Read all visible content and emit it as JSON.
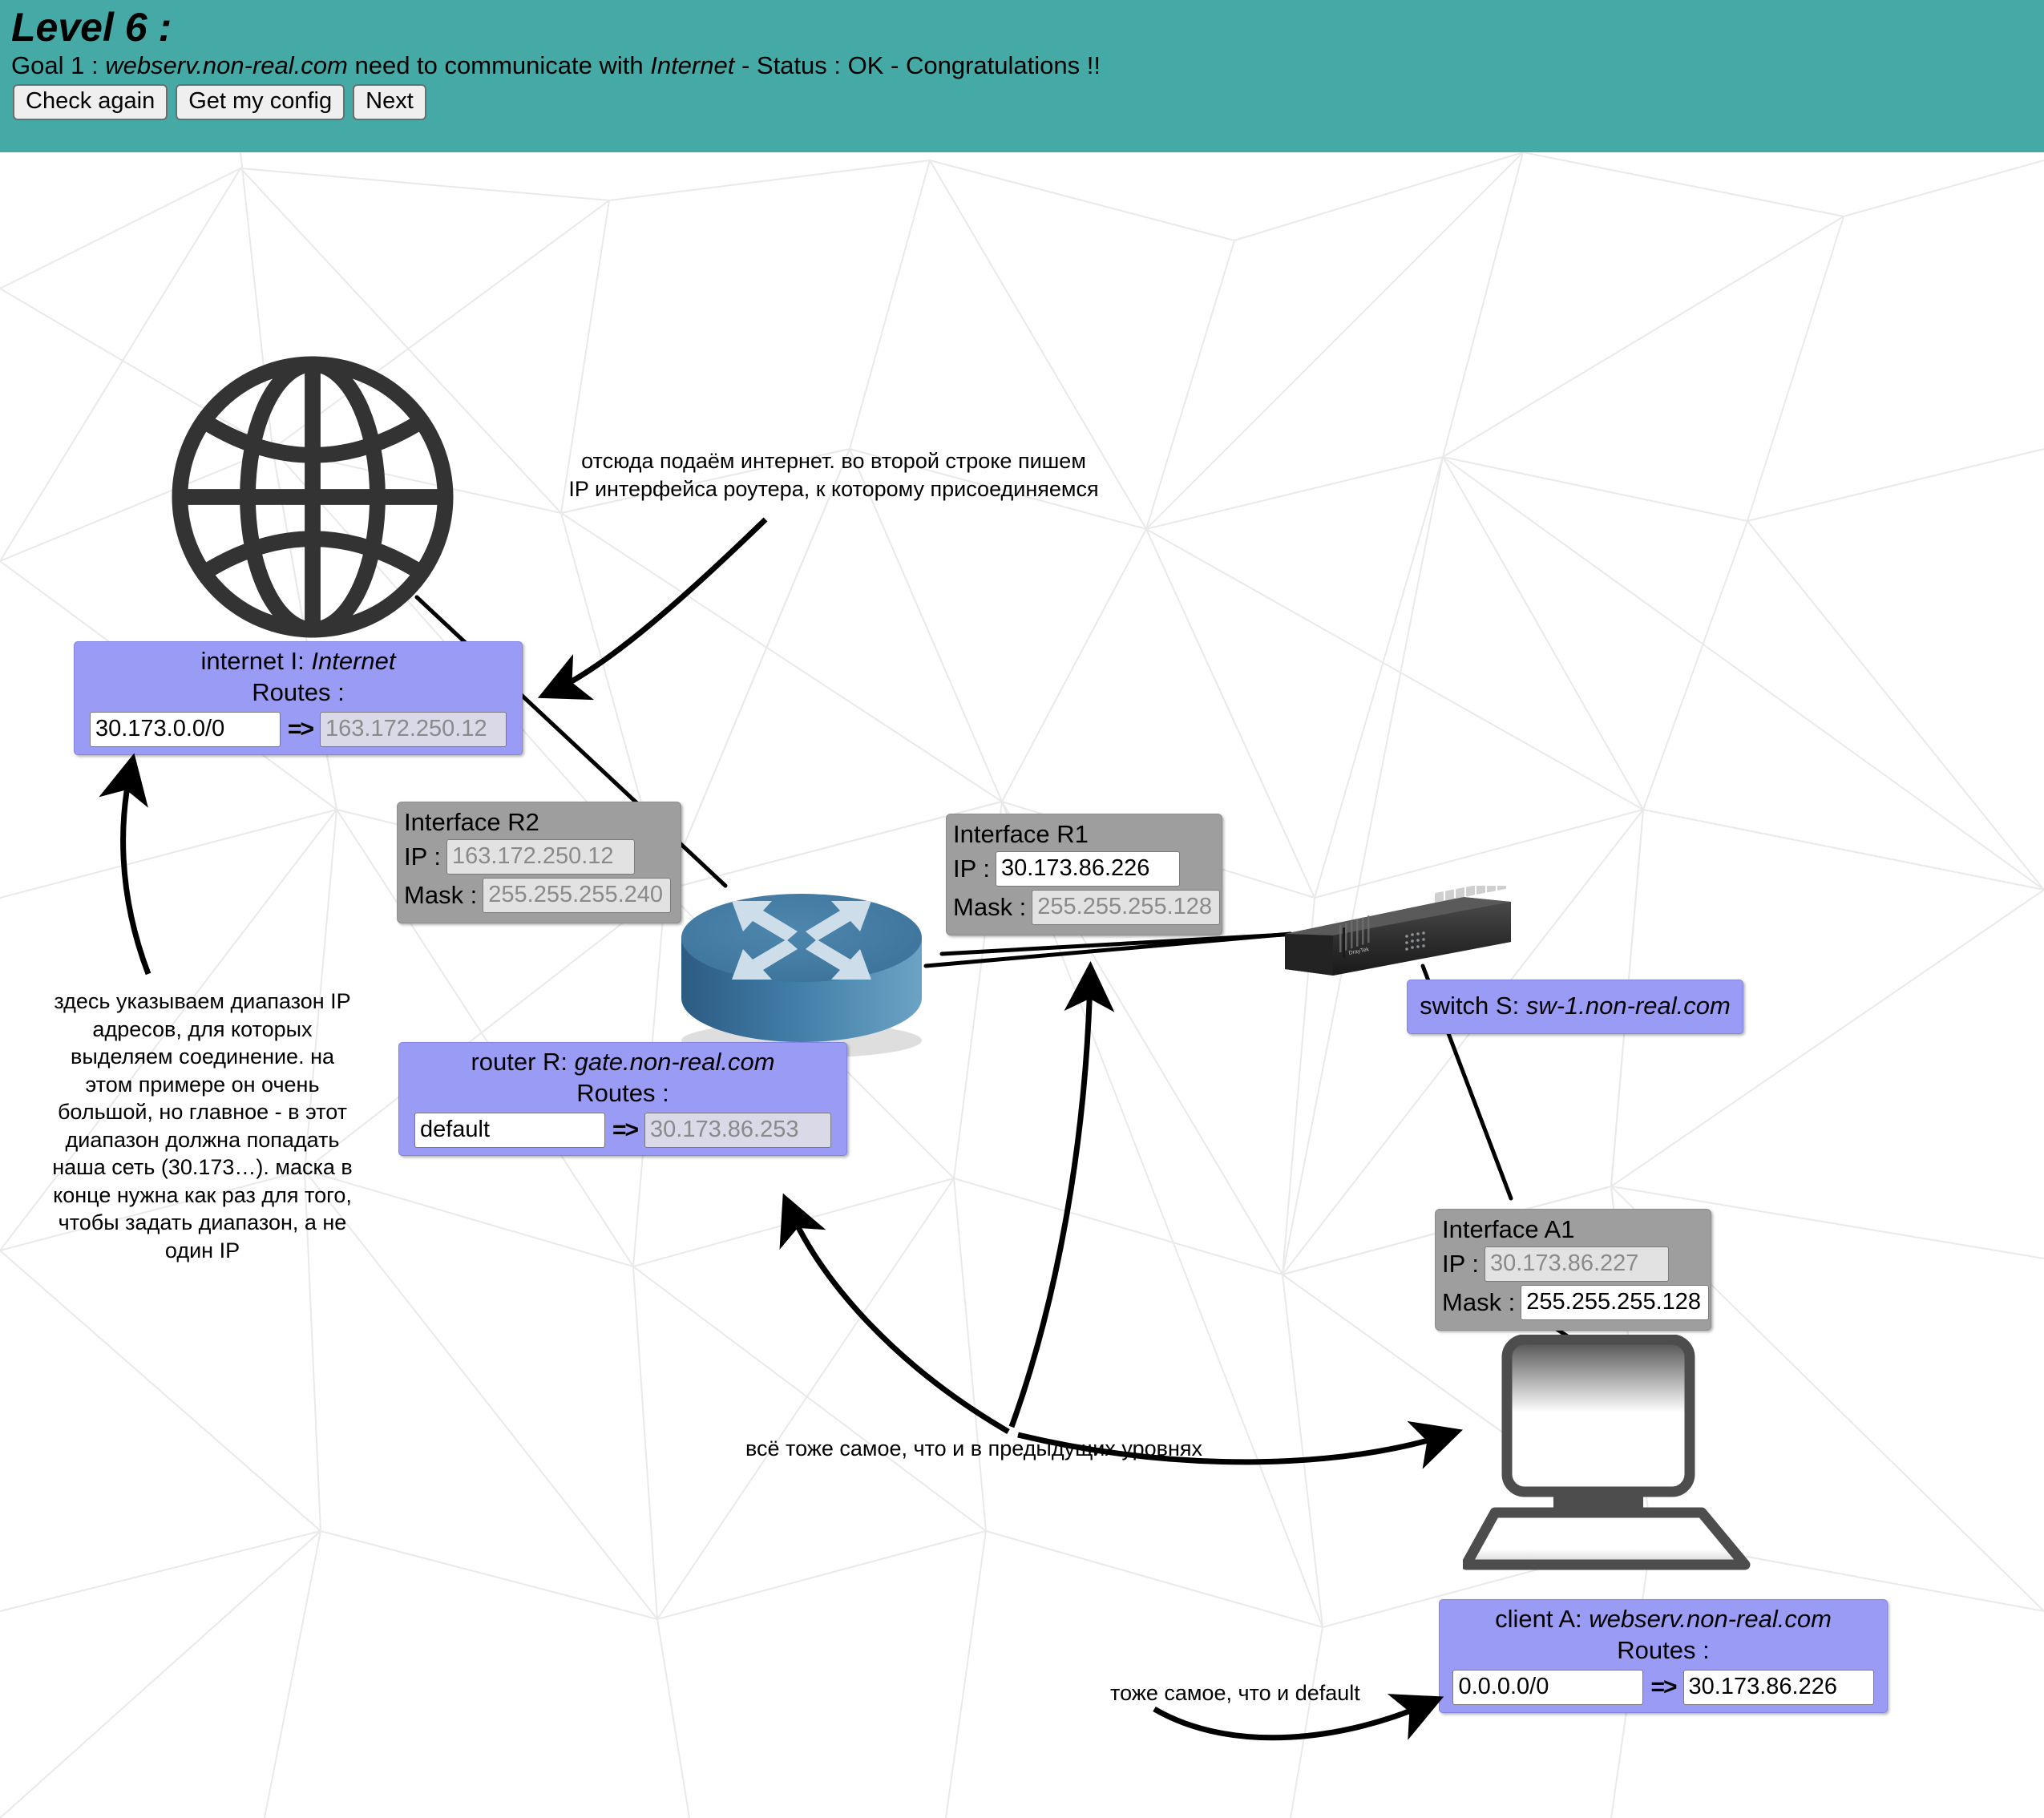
{
  "header": {
    "level_title": "Level 6 :",
    "goal_prefix": "Goal 1 : ",
    "goal_host": "webserv.non-real.com",
    "goal_middle": " need to communicate with ",
    "goal_target": "Internet",
    "goal_suffix": " - Status : OK - Congratulations !!",
    "bg_color": "#45a9a5",
    "buttons": [
      {
        "label": "Check again",
        "name": "check-again-button"
      },
      {
        "label": "Get my config",
        "name": "get-my-config-button"
      },
      {
        "label": "Next",
        "name": "next-button"
      }
    ]
  },
  "nodes": {
    "internet": {
      "prefix": "internet I: ",
      "name": "Internet",
      "routes_label": "Routes :",
      "route": {
        "dest_value": "30.173.0.0/0",
        "dest_state": "filled",
        "arrow": "=>",
        "gw_value": "163.172.250.12",
        "gw_state": "placeholder"
      }
    },
    "router": {
      "prefix": "router R: ",
      "name": "gate.non-real.com",
      "routes_label": "Routes :",
      "route": {
        "dest_value": "default",
        "dest_state": "filled",
        "arrow": "=>",
        "gw_value": "30.173.86.253",
        "gw_state": "placeholder"
      }
    },
    "switch": {
      "prefix": "switch S: ",
      "name": "sw-1.non-real.com"
    },
    "client": {
      "prefix": "client A: ",
      "name": "webserv.non-real.com",
      "routes_label": "Routes :",
      "route": {
        "dest_value": "0.0.0.0/0",
        "dest_state": "filled",
        "arrow": "=>",
        "gw_value": "30.173.86.226",
        "gw_state": "filled"
      }
    }
  },
  "interfaces": {
    "r2": {
      "title": "Interface R2",
      "ip_label": "IP :",
      "ip_value": "163.172.250.12",
      "ip_state": "placeholder",
      "mask_label": "Mask :",
      "mask_value": "255.255.255.240",
      "mask_state": "placeholder"
    },
    "r1": {
      "title": "Interface R1",
      "ip_label": "IP :",
      "ip_value": "30.173.86.226",
      "ip_state": "filled",
      "mask_label": "Mask :",
      "mask_value": "255.255.255.128",
      "mask_state": "placeholder"
    },
    "a1": {
      "title": "Interface A1",
      "ip_label": "IP :",
      "ip_value": "30.173.86.227",
      "ip_state": "placeholder",
      "mask_label": "Mask :",
      "mask_value": "255.255.255.128",
      "mask_state": "filled"
    }
  },
  "annotations": {
    "internet_note": "отсюда подаём интернет. во второй строке пишем\nIP интерфейса роутера, к которому присоединяемся",
    "range_note": "здесь указываем диапазон IP\nадресов, для которых\nвыделяем соединение. на\nэтом примере он очень\nбольшой, но главное - в этот\nдиапазон должна попадать\nнаша сеть (30.173…). маска в\nконце нужна как раз для того,\nчтобы задать диапазон, а не\nодин IP",
    "same_as_previous": "всё тоже самое, что и в предыдущих уровнях",
    "same_as_default": "тоже самое, что и default"
  },
  "icons": {
    "globe": "globe-icon",
    "router": "router-icon",
    "switch": "switch-icon",
    "computer": "computer-icon"
  },
  "colors": {
    "header_teal": "#45a9a5",
    "node_purple": "#9a9bf4",
    "interface_grey": "#9e9e9e",
    "router_blue": "#3f7ca6"
  }
}
